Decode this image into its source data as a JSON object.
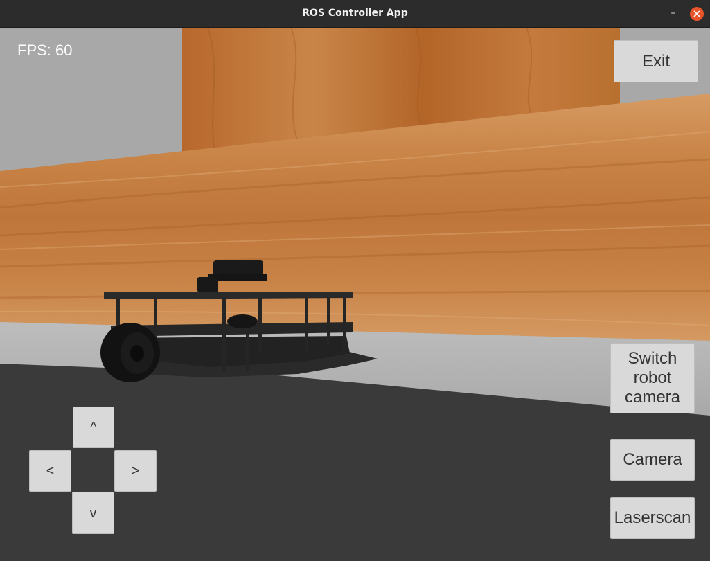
{
  "window": {
    "title": "ROS Controller App",
    "minimize_icon": "minimize-icon",
    "close_icon": "close-icon",
    "close_color": "#e9542b"
  },
  "hud": {
    "fps_text": "FPS: 60"
  },
  "buttons": {
    "exit": "Exit",
    "switch_robot_camera": "Switch robot camera",
    "camera": "Camera",
    "laserscan": "Laserscan"
  },
  "dpad": {
    "up": "^",
    "left": "<",
    "right": ">",
    "down": "v"
  },
  "scene": {
    "wall_color": "#c07a3e",
    "floor_color": "#3a3a3a",
    "ground_color": "#b5b5b5",
    "robot_color": "#1e1e1e"
  }
}
